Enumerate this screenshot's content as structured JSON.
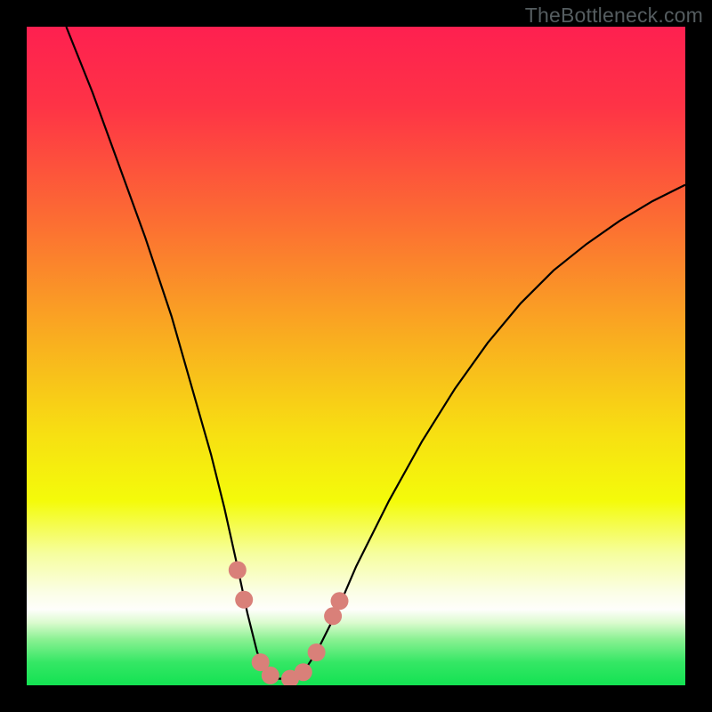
{
  "watermark": "TheBottleneck.com",
  "chart_data": {
    "type": "line",
    "title": "",
    "xlabel": "",
    "ylabel": "",
    "xlim": [
      0,
      100
    ],
    "ylim": [
      0,
      100
    ],
    "grid": false,
    "legend": false,
    "series": [
      {
        "name": "curve",
        "x": [
          6,
          10,
          14,
          18,
          22,
          26,
          28,
          30,
          32,
          33.5,
          35,
          36.5,
          38,
          40,
          42,
          44,
          47,
          50,
          55,
          60,
          65,
          70,
          75,
          80,
          85,
          90,
          95,
          100
        ],
        "y": [
          100,
          90,
          79,
          68,
          56,
          42,
          35,
          27,
          18,
          11,
          5,
          2,
          1,
          1,
          2,
          5,
          11,
          18,
          28,
          37,
          45,
          52,
          58,
          63,
          67,
          70.5,
          73.5,
          76
        ]
      }
    ],
    "markers": {
      "name": "highlight-dots",
      "color": "#d98079",
      "radius_px": 10,
      "points": [
        {
          "x": 32.0,
          "y": 17.5
        },
        {
          "x": 33.0,
          "y": 13.0
        },
        {
          "x": 35.5,
          "y": 3.5
        },
        {
          "x": 37.0,
          "y": 1.5
        },
        {
          "x": 40.0,
          "y": 1.0
        },
        {
          "x": 42.0,
          "y": 2.0
        },
        {
          "x": 44.0,
          "y": 5.0
        },
        {
          "x": 46.5,
          "y": 10.5
        },
        {
          "x": 47.5,
          "y": 12.8
        }
      ]
    },
    "background_gradient": {
      "stops": [
        {
          "offset": 0.0,
          "color": "#fe2050"
        },
        {
          "offset": 0.12,
          "color": "#fe3346"
        },
        {
          "offset": 0.3,
          "color": "#fc6f32"
        },
        {
          "offset": 0.48,
          "color": "#f9b01f"
        },
        {
          "offset": 0.62,
          "color": "#f7e012"
        },
        {
          "offset": 0.72,
          "color": "#f4fb0a"
        },
        {
          "offset": 0.8,
          "color": "#f6fe9e"
        },
        {
          "offset": 0.86,
          "color": "#fbfee7"
        },
        {
          "offset": 0.885,
          "color": "#fefefb"
        },
        {
          "offset": 0.905,
          "color": "#dbfbce"
        },
        {
          "offset": 0.93,
          "color": "#8bf193"
        },
        {
          "offset": 0.965,
          "color": "#35e765"
        },
        {
          "offset": 1.0,
          "color": "#13e252"
        }
      ]
    }
  }
}
